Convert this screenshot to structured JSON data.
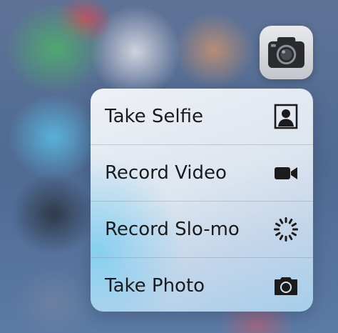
{
  "app_icon": {
    "icon": "camera-icon"
  },
  "quick_actions": {
    "items": [
      {
        "label": "Take Selfie",
        "icon": "selfie-portrait-icon"
      },
      {
        "label": "Record Video",
        "icon": "video-camera-icon"
      },
      {
        "label": "Record Slo-mo",
        "icon": "slo-mo-icon"
      },
      {
        "label": "Take Photo",
        "icon": "camera-icon"
      }
    ]
  },
  "colors": {
    "label_text": "#1b1b1e",
    "icon_fill": "#1b1b1e"
  }
}
